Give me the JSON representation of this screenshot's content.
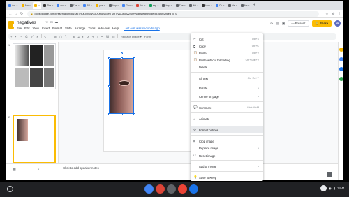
{
  "browser": {
    "tabs": [
      {
        "label": "Am",
        "fav": "#4285f4"
      },
      {
        "label": "Am",
        "fav": "#f4b400"
      },
      {
        "label": "",
        "fav": "#f4b400",
        "active": true
      },
      {
        "label": "The",
        "fav": "#333333"
      },
      {
        "label": "cro",
        "fav": "#4285f4"
      },
      {
        "label": "The",
        "fav": "#5f6368"
      },
      {
        "label": "RP",
        "fav": "#4285f4"
      },
      {
        "label": "yes",
        "fav": "#f4b400"
      },
      {
        "label": "App",
        "fav": "#5f6368"
      },
      {
        "label": "Goo",
        "fav": "#4285f4"
      },
      {
        "label": "Wh",
        "fav": "#db4437"
      },
      {
        "label": "exp",
        "fav": "#0f9d58"
      },
      {
        "label": "Imp",
        "fav": "#5f6368"
      },
      {
        "label": "The",
        "fav": "#5f6368"
      },
      {
        "label": "Wri",
        "fav": "#5f6368"
      },
      {
        "label": "Hov",
        "fav": "#333333"
      },
      {
        "label": "Ch",
        "fav": "#4285f4"
      },
      {
        "label": "Ale",
        "fav": "#5f6368"
      },
      {
        "label": "Ne",
        "fav": "#5f6368"
      }
    ],
    "url": "docs.google.com/presentation/d/1sz57hQlD0lGW03DOMAV53HTMbTiVDQBQ2ZGmyWBw/edit#slide=id.g8cff29cea_0_0"
  },
  "app": {
    "doc_title": "negatives",
    "menus": [
      "File",
      "Edit",
      "View",
      "Insert",
      "Format",
      "Slide",
      "Arrange",
      "Tools",
      "Add-ons",
      "Help"
    ],
    "last_edit": "Last edit was seconds ago",
    "present_label": "Present",
    "share_label": "Share",
    "avatar_letter": "A",
    "toolbar_replace": "Replace image ▾",
    "toolbar_format": "Form"
  },
  "filmstrip": {
    "slide1_num": "1",
    "slide2_num": "2"
  },
  "speaker_notes": "Click to add speaker notes",
  "context_menu": {
    "items": [
      {
        "label": "Cut",
        "shortcut": "Ctrl+X",
        "icon": "✂"
      },
      {
        "label": "Copy",
        "shortcut": "Ctrl+C",
        "icon": "⧉"
      },
      {
        "label": "Paste",
        "shortcut": "Ctrl+V",
        "icon": "📋"
      },
      {
        "label": "Paste without formatting",
        "shortcut": "Ctrl+Shift+V",
        "icon": "📋"
      },
      {
        "label": "Delete",
        "shortcut": "",
        "icon": ""
      },
      {
        "label": "Alt text",
        "shortcut": "Ctrl+Alt+Y",
        "icon": ""
      },
      {
        "label": "Rotate",
        "shortcut": "▸",
        "icon": ""
      },
      {
        "label": "Centre on page",
        "shortcut": "▸",
        "icon": ""
      },
      {
        "label": "Comment",
        "shortcut": "Ctrl+Alt+M",
        "icon": "💬"
      },
      {
        "label": "Animate",
        "shortcut": "",
        "icon": "◐"
      },
      {
        "label": "Format options",
        "shortcut": "",
        "icon": "⚙"
      },
      {
        "label": "Crop image",
        "shortcut": "",
        "icon": "⌗"
      },
      {
        "label": "Replace image",
        "shortcut": "▸",
        "icon": ""
      },
      {
        "label": "Reset image",
        "shortcut": "",
        "icon": "↺"
      },
      {
        "label": "Add to theme",
        "shortcut": "▸",
        "icon": ""
      },
      {
        "label": "Save to Keep",
        "shortcut": "",
        "icon": "💡"
      }
    ]
  },
  "shelf": {
    "time": "14:41",
    "apps": [
      "#4285f4",
      "#db4437",
      "#5f6368",
      "#ea4335",
      "#1a73e8"
    ]
  }
}
